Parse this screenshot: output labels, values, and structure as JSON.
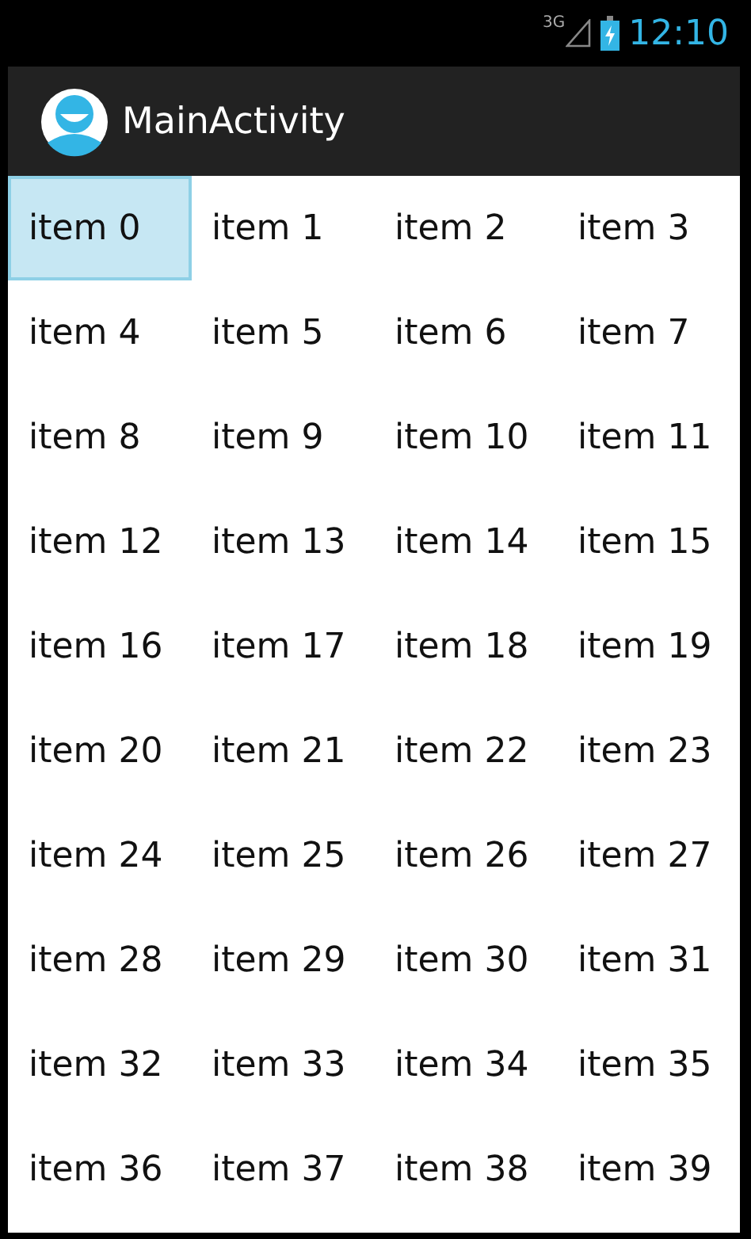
{
  "status_bar": {
    "network": "3G",
    "time": "12:10"
  },
  "action_bar": {
    "title": "MainActivity"
  },
  "grid": {
    "items": [
      {
        "label": "item 0",
        "selected": true
      },
      {
        "label": "item 1",
        "selected": false
      },
      {
        "label": "item 2",
        "selected": false
      },
      {
        "label": "item 3",
        "selected": false
      },
      {
        "label": "item 4",
        "selected": false
      },
      {
        "label": "item 5",
        "selected": false
      },
      {
        "label": "item 6",
        "selected": false
      },
      {
        "label": "item 7",
        "selected": false
      },
      {
        "label": "item 8",
        "selected": false
      },
      {
        "label": "item 9",
        "selected": false
      },
      {
        "label": "item 10",
        "selected": false
      },
      {
        "label": "item 11",
        "selected": false
      },
      {
        "label": "item 12",
        "selected": false
      },
      {
        "label": "item 13",
        "selected": false
      },
      {
        "label": "item 14",
        "selected": false
      },
      {
        "label": "item 15",
        "selected": false
      },
      {
        "label": "item 16",
        "selected": false
      },
      {
        "label": "item 17",
        "selected": false
      },
      {
        "label": "item 18",
        "selected": false
      },
      {
        "label": "item 19",
        "selected": false
      },
      {
        "label": "item 20",
        "selected": false
      },
      {
        "label": "item 21",
        "selected": false
      },
      {
        "label": "item 22",
        "selected": false
      },
      {
        "label": "item 23",
        "selected": false
      },
      {
        "label": "item 24",
        "selected": false
      },
      {
        "label": "item 25",
        "selected": false
      },
      {
        "label": "item 26",
        "selected": false
      },
      {
        "label": "item 27",
        "selected": false
      },
      {
        "label": "item 28",
        "selected": false
      },
      {
        "label": "item 29",
        "selected": false
      },
      {
        "label": "item 30",
        "selected": false
      },
      {
        "label": "item 31",
        "selected": false
      },
      {
        "label": "item 32",
        "selected": false
      },
      {
        "label": "item 33",
        "selected": false
      },
      {
        "label": "item 34",
        "selected": false
      },
      {
        "label": "item 35",
        "selected": false
      },
      {
        "label": "item 36",
        "selected": false
      },
      {
        "label": "item 37",
        "selected": false
      },
      {
        "label": "item 38",
        "selected": false
      },
      {
        "label": "item 39",
        "selected": false
      }
    ]
  }
}
